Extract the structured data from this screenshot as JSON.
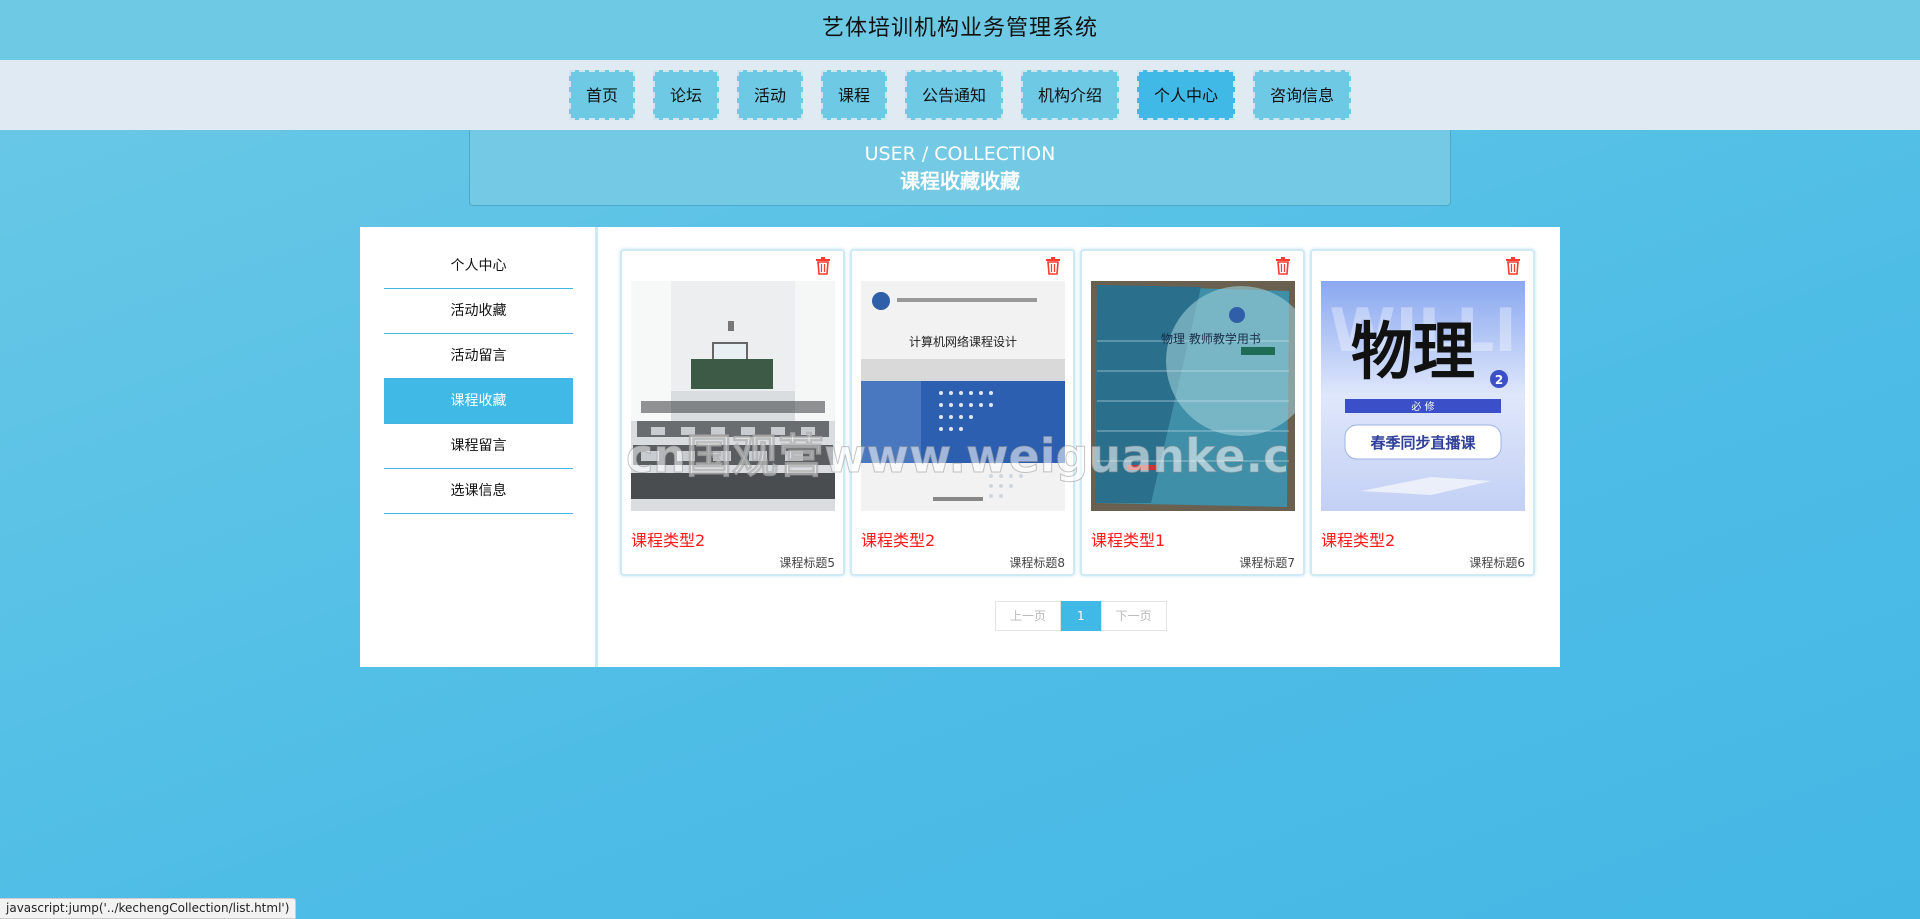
{
  "header": {
    "title": "艺体培训机构业务管理系统"
  },
  "nav": {
    "items": [
      {
        "label": "首页"
      },
      {
        "label": "论坛"
      },
      {
        "label": "活动"
      },
      {
        "label": "课程"
      },
      {
        "label": "公告通知"
      },
      {
        "label": "机构介绍"
      },
      {
        "label": "个人中心"
      },
      {
        "label": "咨询信息"
      }
    ],
    "active": "个人中心"
  },
  "banner": {
    "en": "USER / COLLECTION",
    "cn": "课程收藏收藏"
  },
  "sidebar": {
    "items": [
      {
        "label": "个人中心"
      },
      {
        "label": "活动收藏"
      },
      {
        "label": "活动留言"
      },
      {
        "label": "课程收藏"
      },
      {
        "label": "课程留言"
      },
      {
        "label": "选课信息"
      }
    ],
    "active": "课程收藏"
  },
  "cards": [
    {
      "type": "课程类型2",
      "title": "课程标题5",
      "image": "classroom-photo"
    },
    {
      "type": "课程类型2",
      "title": "课程标题8",
      "image": "book-cover-network-course",
      "cover_text": "计算机网络课程设计"
    },
    {
      "type": "课程类型1",
      "title": "课程标题7",
      "image": "book-cover-physics-teacher",
      "cover_text": "物理 教师教学用书"
    },
    {
      "type": "课程类型2",
      "title": "课程标题6",
      "image": "book-cover-physics-2",
      "cover_text": "物理",
      "cover_badge": "2",
      "cover_band": "必 修",
      "cover_button": "春季同步直播课"
    }
  ],
  "pagination": {
    "prev": "上一页",
    "current": "1",
    "next": "下一页"
  },
  "status_bar": {
    "text": "javascript:jump('../kechengCollection/list.html')"
  },
  "watermark": {
    "text": "cn国观营www.weiguanke.cn"
  },
  "colors": {
    "accent": "#41b9e6",
    "card_type": "#ff1a1a",
    "header_bg": "#6ec9e4"
  }
}
